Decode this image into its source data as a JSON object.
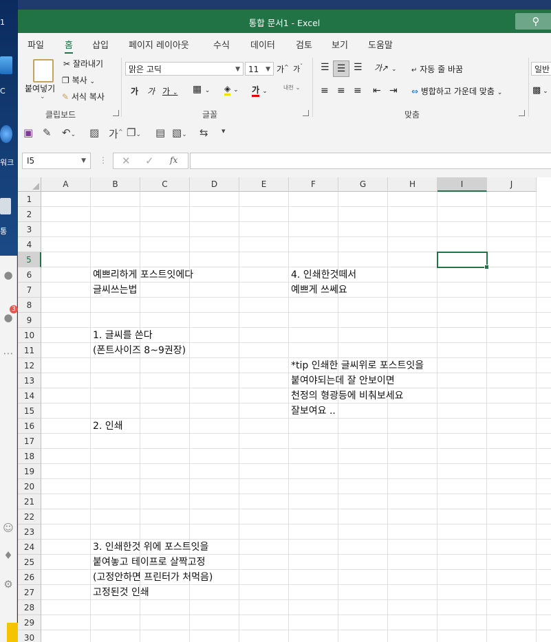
{
  "window": {
    "title": "통합 문서1  -  Excel"
  },
  "desktop": {
    "labels": [
      "1",
      "C",
      "워크",
      "통"
    ],
    "badge": "3"
  },
  "ribbon_tabs": [
    "파일",
    "홈",
    "삽입",
    "페이지 레이아웃",
    "수식",
    "데이터",
    "검토",
    "보기",
    "도움말"
  ],
  "active_tab": "홈",
  "clipboard": {
    "paste": "붙여넣기",
    "cut": "잘라내기",
    "copy": "복사",
    "format_painter": "서식 복사",
    "group": "클립보드"
  },
  "font": {
    "name": "맑은 고딕",
    "size": "11",
    "grow": "가",
    "shrink": "가",
    "bold": "가",
    "italic": "가",
    "underline": "가",
    "color_glyph": "가",
    "phonetic": "내천",
    "group": "글꼴"
  },
  "alignment": {
    "wrap": "자동 줄 바꿈",
    "merge": "병합하고 가운데 맞춤",
    "group": "맞춤",
    "orient": "가"
  },
  "number": {
    "format": "일반"
  },
  "formula_bar": {
    "name_box": "I5",
    "fx": "fx",
    "value": ""
  },
  "columns": [
    "A",
    "B",
    "C",
    "D",
    "E",
    "F",
    "G",
    "H",
    "I",
    "J"
  ],
  "selected_column": "I",
  "selected_row": "5",
  "rows": [
    "1",
    "2",
    "3",
    "4",
    "5",
    "6",
    "7",
    "8",
    "9",
    "10",
    "11",
    "12",
    "13",
    "14",
    "15",
    "16",
    "17",
    "18",
    "19",
    "20",
    "21",
    "22",
    "23",
    "24",
    "25",
    "26",
    "27",
    "28",
    "29",
    "30"
  ],
  "cells": [
    {
      "ref": "B6",
      "text": "예쁘리하게 포스트잇에다"
    },
    {
      "ref": "B7",
      "text": "글씨쓰는법"
    },
    {
      "ref": "B10",
      "text": "1. 글씨를 쓴다"
    },
    {
      "ref": "B11",
      "text": "(폰트사이즈 8~9권장)"
    },
    {
      "ref": "B16",
      "text": "2. 인쇄"
    },
    {
      "ref": "B24",
      "text": "3. 인쇄한것 위에 포스트잇을"
    },
    {
      "ref": "B25",
      "text": "붙여놓고 테이프로 살짝고정"
    },
    {
      "ref": "B26",
      "text": "(고정안하면 프린터가 처먹음)"
    },
    {
      "ref": "B27",
      "text": "고정된것 인쇄"
    },
    {
      "ref": "F6",
      "text": "4. 인쇄한것떼서"
    },
    {
      "ref": "F7",
      "text": "예쁘게 쓰쎄요"
    },
    {
      "ref": "F12",
      "text": "*tip 인쇄한 글씨위로 포스트잇을"
    },
    {
      "ref": "F13",
      "text": "붙여야되는데 잘 안보이면"
    },
    {
      "ref": "F14",
      "text": "천정의 형광등에 비춰보세요"
    },
    {
      "ref": "F15",
      "text": "잘보여요 .."
    }
  ],
  "colors": {
    "excel_green": "#217346",
    "ribbon_bg": "#f3f3f3"
  }
}
